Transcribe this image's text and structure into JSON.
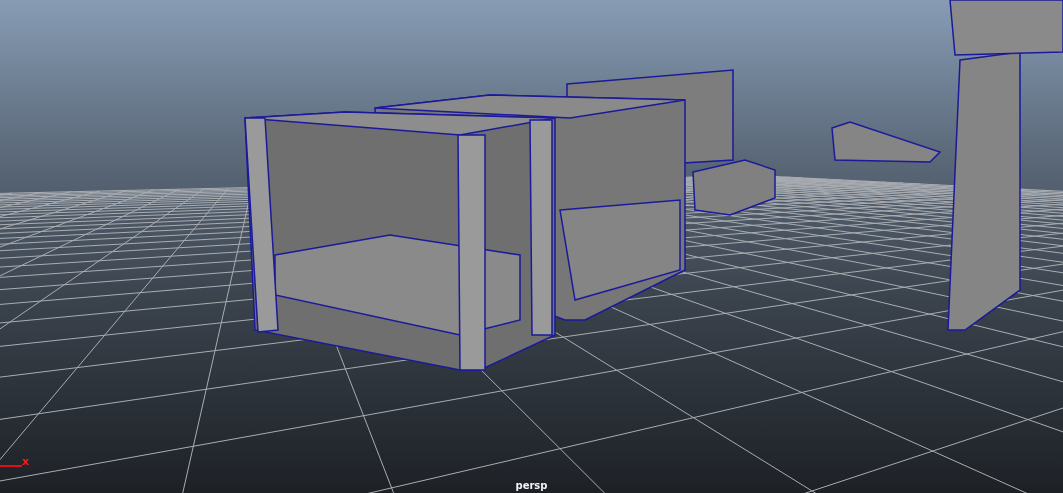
{
  "viewport": {
    "camera_label": "persp",
    "axis_label": "x"
  }
}
